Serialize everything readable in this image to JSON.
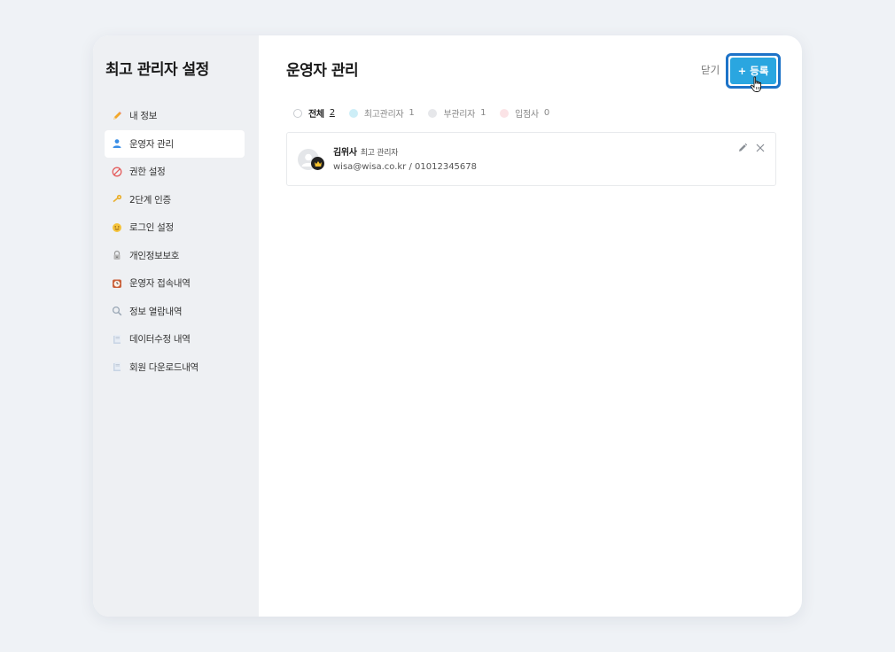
{
  "sidebar": {
    "title": "최고 관리자 설정",
    "items": [
      {
        "label": "내 정보",
        "icon": "pencil-icon"
      },
      {
        "label": "운영자 관리",
        "icon": "person-icon",
        "active": true
      },
      {
        "label": "권한 설정",
        "icon": "prohibited-icon"
      },
      {
        "label": "2단계 인증",
        "icon": "key-icon"
      },
      {
        "label": "로그인 설정",
        "icon": "smiley-icon"
      },
      {
        "label": "개인정보보호",
        "icon": "lock-icon"
      },
      {
        "label": "운영자 접속내역",
        "icon": "clock-icon"
      },
      {
        "label": "정보 열람내역",
        "icon": "magnifier-icon"
      },
      {
        "label": "데이터수정 내역",
        "icon": "document-icon"
      },
      {
        "label": "회원 다운로드내역",
        "icon": "document-icon"
      }
    ]
  },
  "main": {
    "title": "운영자 관리",
    "close_label": "닫기",
    "register_label": "+ 등록",
    "filters": [
      {
        "label": "전체",
        "count": "2",
        "color": "#ffffff"
      },
      {
        "label": "최고관리자",
        "count": "1",
        "color": "#cdeef7"
      },
      {
        "label": "부관리자",
        "count": "1",
        "color": "#e6e7ea"
      },
      {
        "label": "입점사",
        "count": "0",
        "color": "#fbe3e6"
      }
    ],
    "operators": [
      {
        "name": "김위사",
        "role": "최고 관리자",
        "contact": "wisa@wisa.co.kr / 01012345678"
      }
    ]
  },
  "colors": {
    "accent": "#2aa6e0",
    "focus_ring": "#1d73c8",
    "sidebar_bg": "#eef0f3",
    "page_bg": "#eff2f6"
  }
}
